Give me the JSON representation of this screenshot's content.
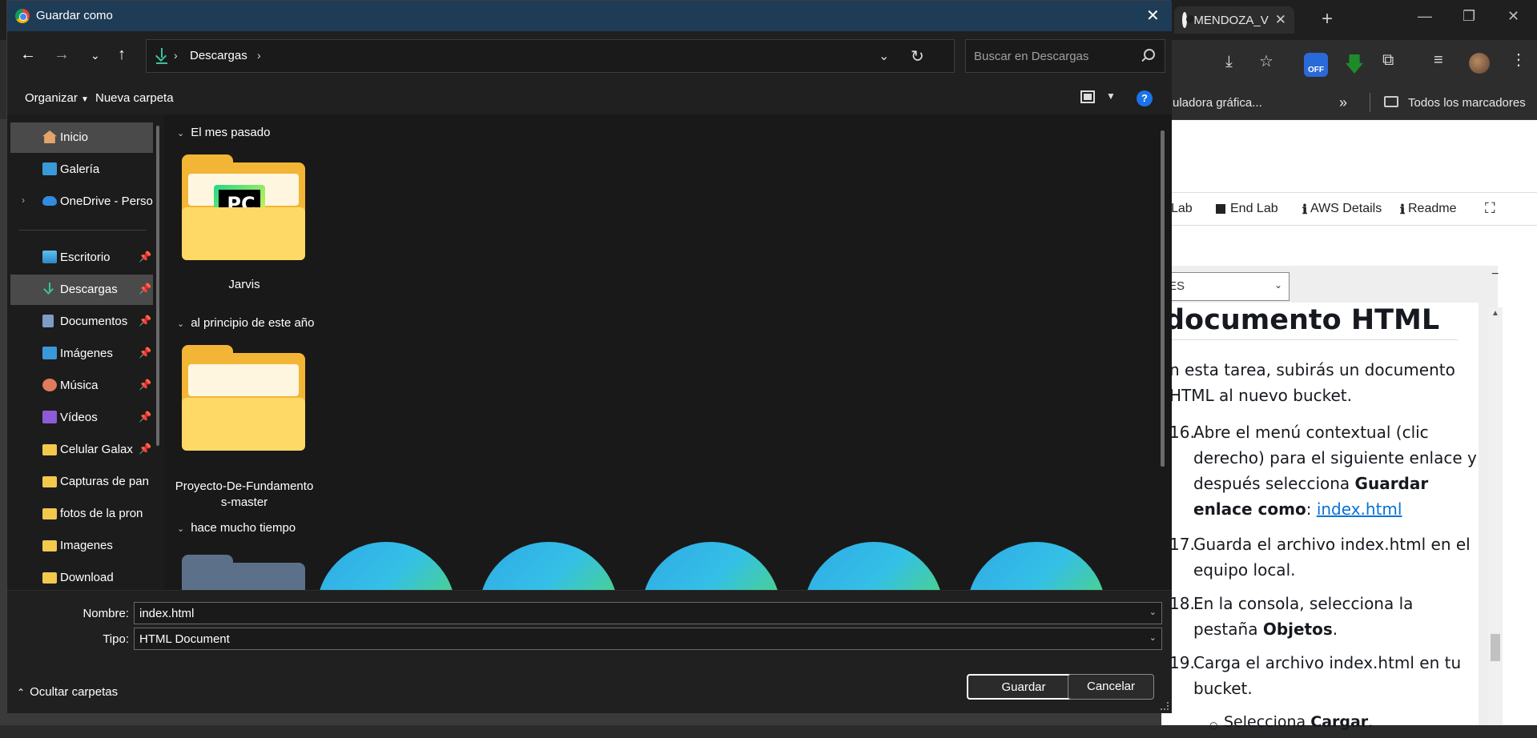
{
  "browser": {
    "tab_title": "MENDOZA_V",
    "bookmarks": {
      "partial_item": "uladora gráfica...",
      "overflow": "»",
      "all_bookmarks": "Todos los marcadores"
    },
    "ext_badge": "OFF",
    "page": {
      "nav": [
        "Lab",
        "End Lab",
        "AWS Details",
        "Readme"
      ],
      "lang_select": "ES",
      "heading": "documento HTML",
      "intro_lines": [
        "n esta tarea, subirás un documento",
        "HTML al nuevo bucket."
      ],
      "steps": [
        {
          "num": "16.",
          "line1": "Abre el menú contextual (clic",
          "line2": "derecho) para el siguiente enlace y",
          "line3_a": "después selecciona ",
          "line3_b": "Guardar",
          "line4_a": "enlace como",
          "line4_b": ": ",
          "link": "index.html"
        },
        {
          "num": "17.",
          "line1": "Guarda el archivo index.html en el",
          "line2": "equipo local."
        },
        {
          "num": "18.",
          "line1": "En la consola, selecciona la",
          "line2_a": "pestaña ",
          "line2_b": "Objetos",
          "line2_c": "."
        },
        {
          "num": "19.",
          "line1": "Carga el archivo index.html en tu",
          "line2": "bucket."
        }
      ],
      "sub_bullet_a": "Selecciona ",
      "sub_bullet_b": "Cargar",
      "sub_bullet_c": "."
    }
  },
  "dialog": {
    "title": "Guardar como",
    "breadcrumb": "Descargas",
    "search_placeholder": "Buscar en Descargas",
    "commands": {
      "organize": "Organizar",
      "new_folder": "Nueva carpeta"
    },
    "help_label": "?",
    "sidebar": [
      {
        "label": "Inicio",
        "icon": "home-icon"
      },
      {
        "label": "Galería",
        "icon": "gallery-icon"
      },
      {
        "label": "OneDrive - Perso",
        "icon": "cloud-icon"
      },
      {
        "label": "Escritorio",
        "icon": "desktop-icon"
      },
      {
        "label": "Descargas",
        "icon": "download-icon"
      },
      {
        "label": "Documentos",
        "icon": "documents-icon"
      },
      {
        "label": "Imágenes",
        "icon": "pictures-icon"
      },
      {
        "label": "Música",
        "icon": "music-icon"
      },
      {
        "label": "Vídeos",
        "icon": "videos-icon"
      },
      {
        "label": "Celular Galax",
        "icon": "folder-icon"
      },
      {
        "label": "Capturas de pan",
        "icon": "folder-icon"
      },
      {
        "label": "fotos de la pron",
        "icon": "folder-icon"
      },
      {
        "label": "Imagenes",
        "icon": "folder-icon"
      },
      {
        "label": "Download",
        "icon": "folder-icon"
      }
    ],
    "groups": [
      {
        "label": "El mes pasado",
        "items": [
          {
            "name": "Jarvis"
          }
        ]
      },
      {
        "label": "al principio de este año",
        "items": [
          {
            "name_line1": "Proyecto-De-Fundamento",
            "name_line2": "s-master"
          }
        ]
      },
      {
        "label": "hace mucho tiempo"
      }
    ],
    "pc_badge": "PC",
    "filename_label": "Nombre:",
    "filename_value": "index.html",
    "type_label": "Tipo:",
    "type_value": "HTML Document",
    "save_label": "Guardar",
    "cancel_label": "Cancelar",
    "hide_folders_label": "Ocultar carpetas"
  }
}
